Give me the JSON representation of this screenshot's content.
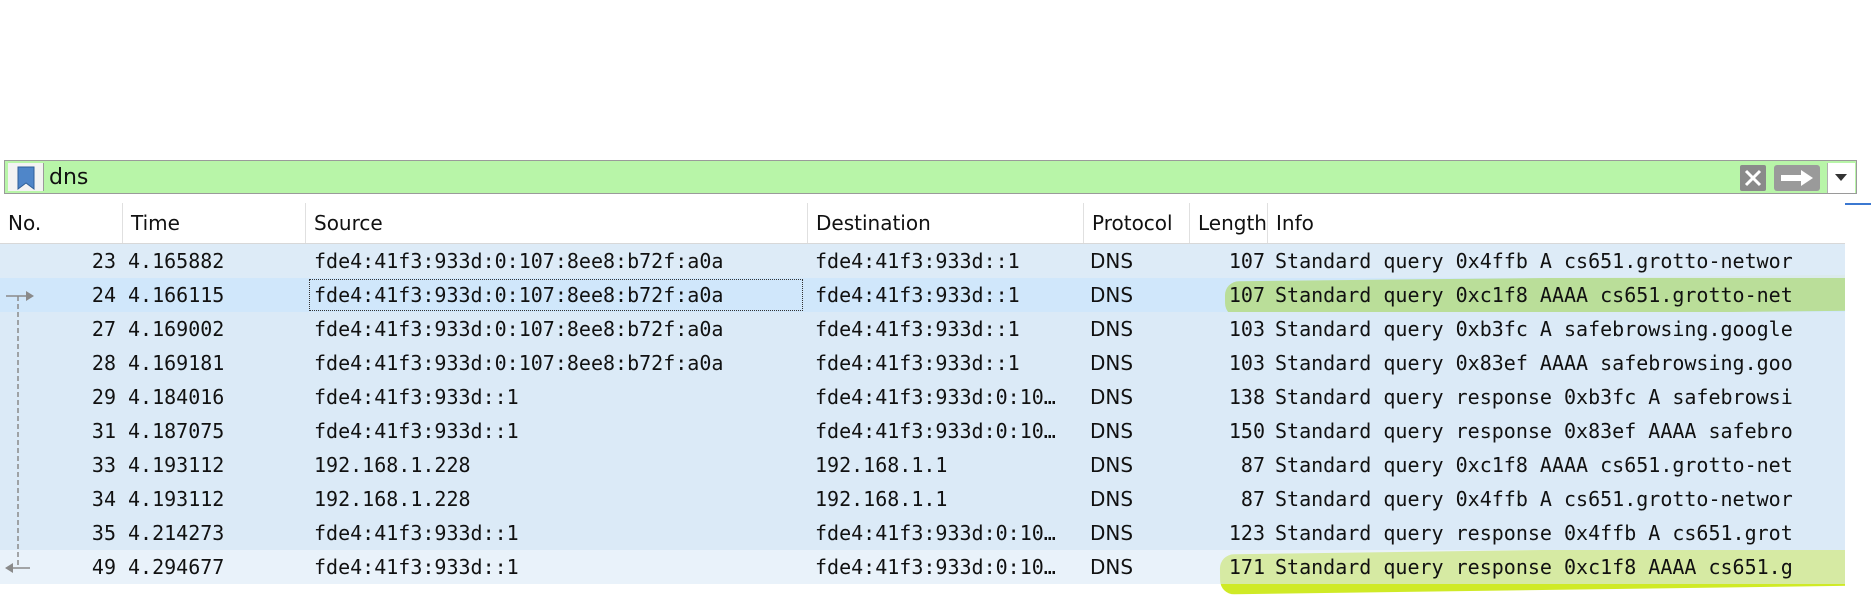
{
  "filter": {
    "value": "dns",
    "icons": {
      "bookmark": "bookmark-icon",
      "clear": "clear-x-icon",
      "apply": "arrow-right-icon",
      "dropdown": "chevron-down-icon"
    }
  },
  "columns": {
    "no": "No.",
    "time": "Time",
    "source": "Source",
    "destination": "Destination",
    "protocol": "Protocol",
    "length": "Length",
    "info": "Info"
  },
  "packets": [
    {
      "no": "23",
      "time": "4.165882",
      "source": "fde4:41f3:933d:0:107:8ee8:b72f:a0a",
      "destination": "fde4:41f3:933d::1",
      "protocol": "DNS",
      "length": "107",
      "info": "Standard query 0x4ffb A cs651.grotto-networ"
    },
    {
      "no": "24",
      "time": "4.166115",
      "source": "fde4:41f3:933d:0:107:8ee8:b72f:a0a",
      "destination": "fde4:41f3:933d::1",
      "protocol": "DNS",
      "length": "107",
      "info": "Standard query 0xc1f8 AAAA cs651.grotto-net"
    },
    {
      "no": "27",
      "time": "4.169002",
      "source": "fde4:41f3:933d:0:107:8ee8:b72f:a0a",
      "destination": "fde4:41f3:933d::1",
      "protocol": "DNS",
      "length": "103",
      "info": "Standard query 0xb3fc A safebrowsing.google"
    },
    {
      "no": "28",
      "time": "4.169181",
      "source": "fde4:41f3:933d:0:107:8ee8:b72f:a0a",
      "destination": "fde4:41f3:933d::1",
      "protocol": "DNS",
      "length": "103",
      "info": "Standard query 0x83ef AAAA safebrowsing.goo"
    },
    {
      "no": "29",
      "time": "4.184016",
      "source": "fde4:41f3:933d::1",
      "destination": "fde4:41f3:933d:0:10…",
      "protocol": "DNS",
      "length": "138",
      "info": "Standard query response 0xb3fc A safebrowsi"
    },
    {
      "no": "31",
      "time": "4.187075",
      "source": "fde4:41f3:933d::1",
      "destination": "fde4:41f3:933d:0:10…",
      "protocol": "DNS",
      "length": "150",
      "info": "Standard query response 0x83ef AAAA safebro"
    },
    {
      "no": "33",
      "time": "4.193112",
      "source": "192.168.1.228",
      "destination": "192.168.1.1",
      "protocol": "DNS",
      "length": "87",
      "info": "Standard query 0xc1f8 AAAA cs651.grotto-net"
    },
    {
      "no": "34",
      "time": "4.193112",
      "source": "192.168.1.228",
      "destination": "192.168.1.1",
      "protocol": "DNS",
      "length": "87",
      "info": "Standard query 0x4ffb A cs651.grotto-networ"
    },
    {
      "no": "35",
      "time": "4.214273",
      "source": "fde4:41f3:933d::1",
      "destination": "fde4:41f3:933d:0:10…",
      "protocol": "DNS",
      "length": "123",
      "info": "Standard query response 0x4ffb A cs651.grot"
    },
    {
      "no": "49",
      "time": "4.294677",
      "source": "fde4:41f3:933d::1",
      "destination": "fde4:41f3:933d:0:10…",
      "protocol": "DNS",
      "length": "171",
      "info": "Standard query response 0xc1f8 AAAA cs651.g"
    }
  ],
  "colors": {
    "row_background": "#dbeaf7",
    "selected_row": "#a9d3f7",
    "filter_valid": "#b8f5a8",
    "highlighter": "#c7e600"
  }
}
